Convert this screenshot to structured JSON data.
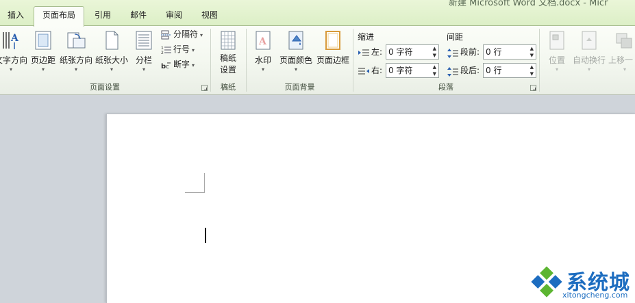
{
  "window": {
    "title": "新建 Microsoft Word 文档.docx - Micr"
  },
  "tabs": [
    {
      "label": "插入",
      "active": false
    },
    {
      "label": "页面布局",
      "active": true
    },
    {
      "label": "引用",
      "active": false
    },
    {
      "label": "邮件",
      "active": false
    },
    {
      "label": "审阅",
      "active": false
    },
    {
      "label": "视图",
      "active": false
    }
  ],
  "page_setup": {
    "text_direction": "文字方向",
    "margins": "页边距",
    "orientation": "纸张方向",
    "size": "纸张大小",
    "columns": "分栏",
    "breaks": "分隔符",
    "line_numbers": "行号",
    "hyphenation": "断字",
    "group_label": "页面设置"
  },
  "draft_paper": {
    "button": "稿纸",
    "button_line2": "设置",
    "group_label": "稿纸"
  },
  "page_background": {
    "watermark": "水印",
    "page_color": "页面颜色",
    "page_borders": "页面边框",
    "group_label": "页面背景"
  },
  "paragraph": {
    "indent_heading": "缩进",
    "left_label": "左:",
    "left_value": "0 字符",
    "right_label": "右:",
    "right_value": "0 字符",
    "spacing_heading": "间距",
    "before_label": "段前:",
    "before_value": "0 行",
    "after_label": "段后:",
    "after_value": "0 行",
    "group_label": "段落"
  },
  "arrange": {
    "position": "位置",
    "wrap_text": "自动换行",
    "bring_forward": "上移一"
  },
  "watermark_logo": {
    "text": "系统城",
    "url": "xitongcheng.com"
  },
  "colors": {
    "tab_strip": "#dcefc6",
    "logo_blue": "#1d6dc0",
    "logo_green": "#5cb531"
  }
}
